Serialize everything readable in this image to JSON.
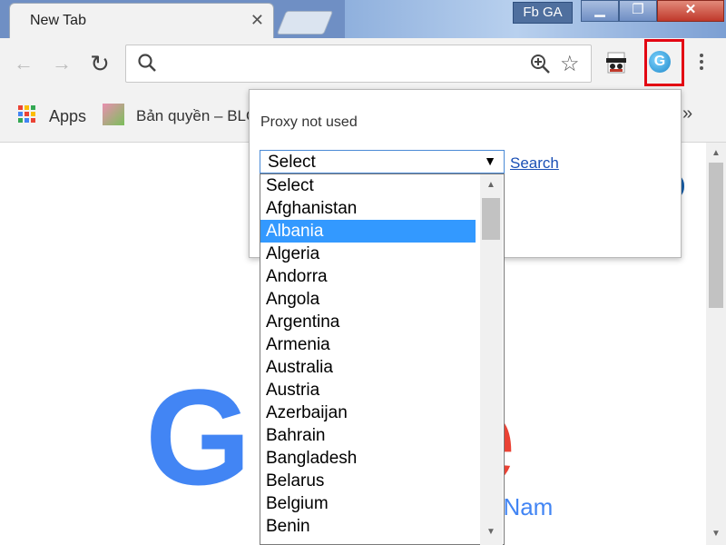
{
  "window": {
    "tab_title": "New Tab",
    "tab_close": "✕",
    "profile_label": "Fb GA",
    "min_glyph": "▁",
    "max_glyph": "❐",
    "close_glyph": "✕"
  },
  "toolbar": {
    "back_glyph": "←",
    "forward_glyph": "→",
    "reload_glyph": "↻",
    "star_glyph": "☆",
    "icons": [
      "back-arrow-icon",
      "forward-arrow-icon",
      "reload-icon",
      "search-icon",
      "zoom-in-icon",
      "star-icon",
      "incognito-extension-icon",
      "proxy-extension-icon",
      "menu-dots-icon"
    ],
    "proxy_letter": "G"
  },
  "bookmarks": {
    "apps_label": "Apps",
    "item_label": "Bản quyền – BLO",
    "more_glyph": "»"
  },
  "page": {
    "region_text": "t Nam"
  },
  "popup": {
    "status": "Proxy not used",
    "select_value": "Select",
    "caret": "▼",
    "search_link": "Search",
    "options": [
      "Select",
      "Afghanistan",
      "Albania",
      "Algeria",
      "Andorra",
      "Angola",
      "Argentina",
      "Armenia",
      "Australia",
      "Austria",
      "Azerbaijan",
      "Bahrain",
      "Bangladesh",
      "Belarus",
      "Belgium",
      "Benin"
    ],
    "highlighted_option": "Albania",
    "highlight_color": "#3399ff"
  },
  "colors": {
    "google_blue": "#4285f4",
    "google_red": "#ea4335",
    "annotation_red": "#e30613"
  }
}
